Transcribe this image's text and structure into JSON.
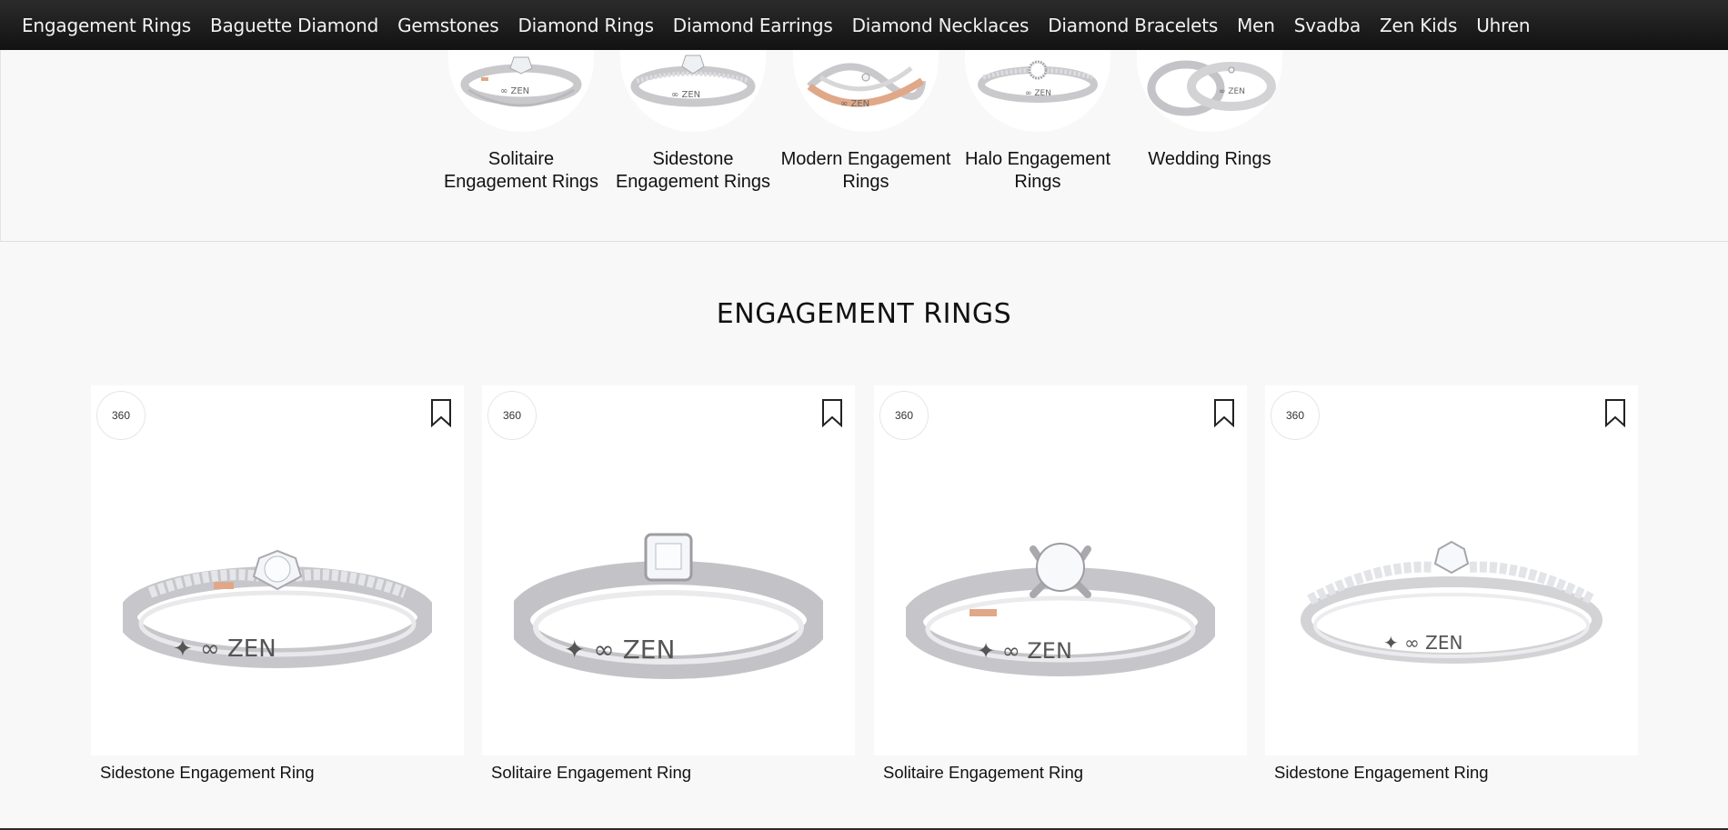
{
  "nav": {
    "items": [
      "Engagement Rings",
      "Baguette Diamond",
      "Gemstones",
      "Diamond Rings",
      "Diamond Earrings",
      "Diamond Necklaces",
      "Diamond Bracelets",
      "Men",
      "Svadba",
      "Zen Kids",
      "Uhren"
    ]
  },
  "categories": [
    {
      "label": "Solitaire Engagement Rings"
    },
    {
      "label": "Sidestone Engagement Rings"
    },
    {
      "label": "Modern Engagement Rings"
    },
    {
      "label": "Halo Engagement Rings"
    },
    {
      "label": "Wedding Rings"
    }
  ],
  "section": {
    "title": "ENGAGEMENT RINGS"
  },
  "products": [
    {
      "name": "Sidestone Engagement Ring",
      "badge": "360",
      "icon": "bookmark-icon"
    },
    {
      "name": "Solitaire Engagement Ring",
      "badge": "360",
      "icon": "bookmark-icon"
    },
    {
      "name": "Solitaire Engagement Ring",
      "badge": "360",
      "icon": "bookmark-icon"
    },
    {
      "name": "Sidestone Engagement Ring",
      "badge": "360",
      "icon": "bookmark-icon"
    }
  ],
  "colors": {
    "nav_bg": "#1c1c1c",
    "page_bg": "#f8f8f8",
    "card_bg": "#ffffff",
    "rose_gold": "#e0a888"
  }
}
